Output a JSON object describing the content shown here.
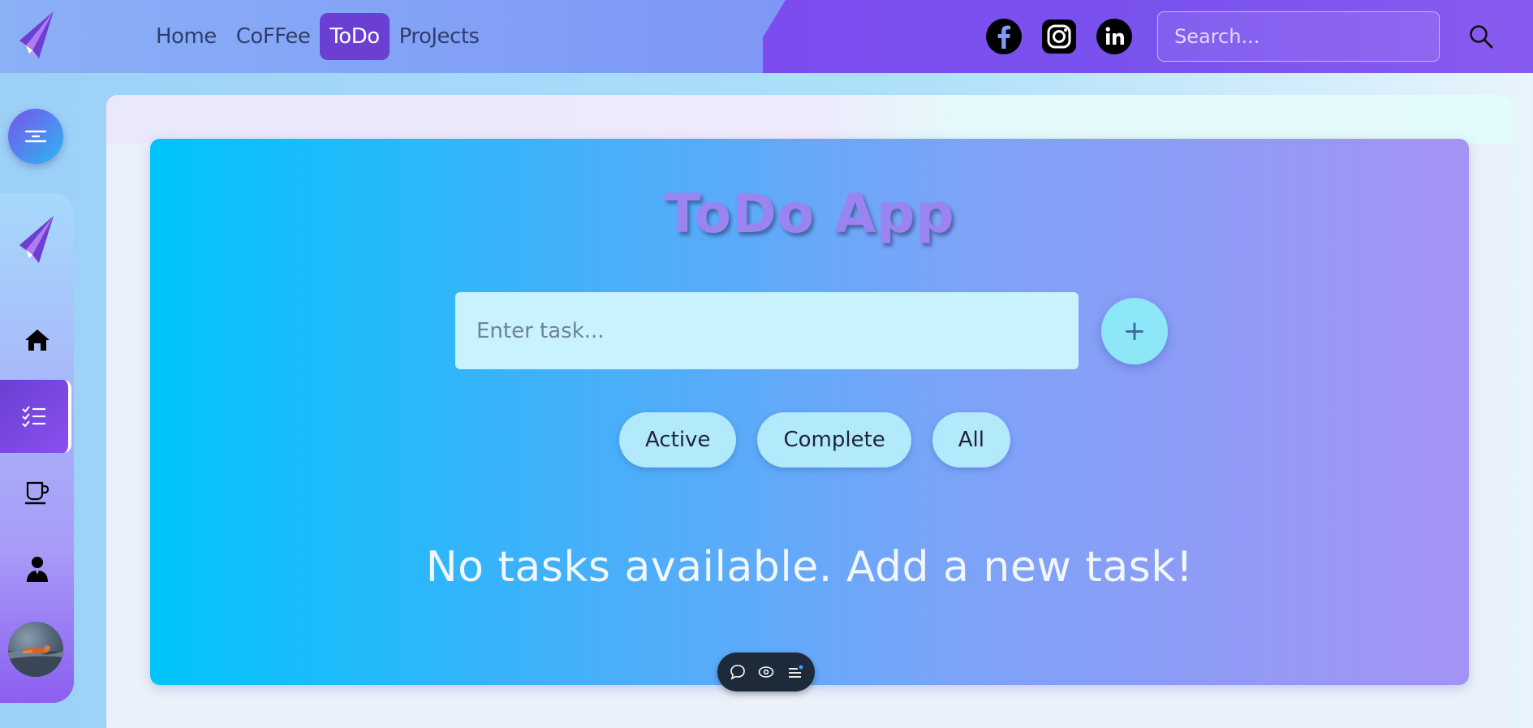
{
  "nav": {
    "items": [
      {
        "label": "Home",
        "active": false
      },
      {
        "label": "CoFFee",
        "active": false
      },
      {
        "label": "ToDo",
        "active": true
      },
      {
        "label": "ProJects",
        "active": false
      }
    ]
  },
  "socials": [
    "facebook-icon",
    "instagram-icon",
    "linkedin-icon"
  ],
  "search": {
    "placeholder": "Search..."
  },
  "sidebar": {
    "items": [
      {
        "icon": "home-icon",
        "active": false
      },
      {
        "icon": "checklist-icon",
        "active": true
      },
      {
        "icon": "coffee-cup-icon",
        "active": false
      },
      {
        "icon": "user-icon",
        "active": false
      }
    ]
  },
  "todo": {
    "title": "ToDo App",
    "input_placeholder": "Enter task...",
    "add_label": "+",
    "filters": [
      "Active",
      "Complete",
      "All"
    ],
    "empty_message": "No tasks available. Add a new task!"
  },
  "colors": {
    "accent": "#6a3fd1",
    "card_start": "#00c4fb",
    "card_end": "#a493f4",
    "title": "#9b83f2"
  }
}
